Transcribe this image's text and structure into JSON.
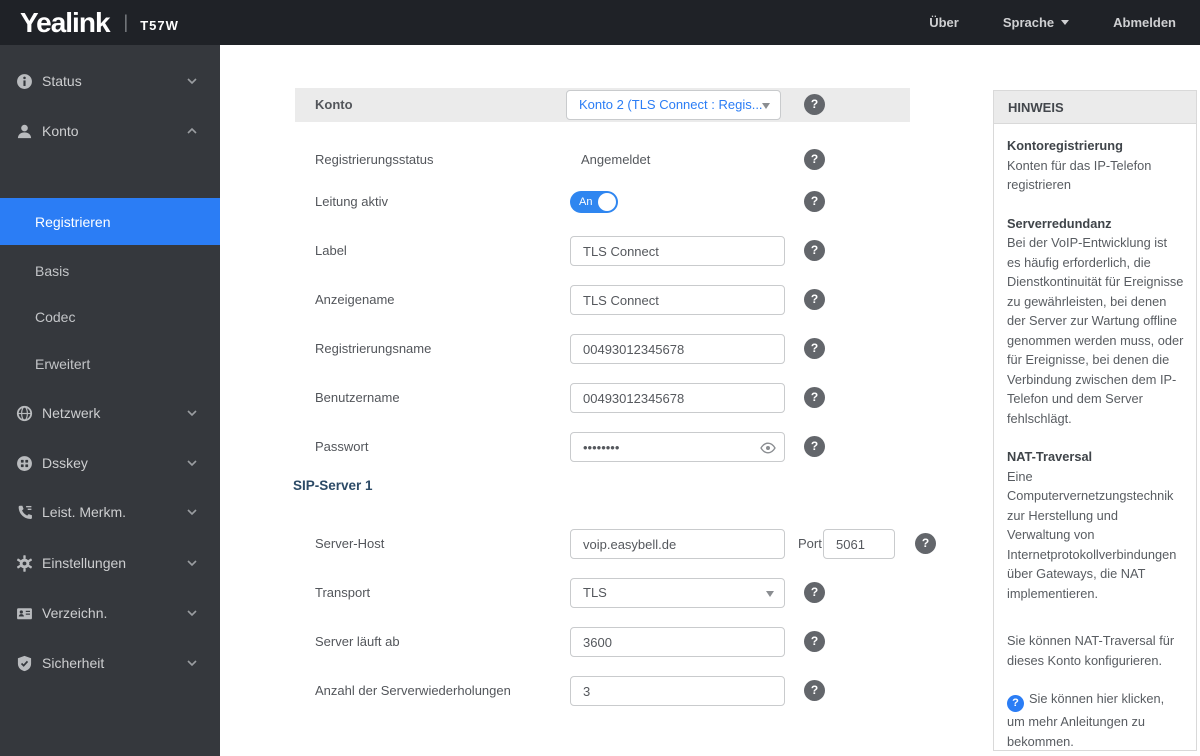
{
  "header": {
    "brand": "Yealink",
    "divider": "|",
    "model": "T57W",
    "links": {
      "about": "Über",
      "language": "Sprache",
      "logout": "Abmelden"
    }
  },
  "sidebar": {
    "items": [
      {
        "label": "Status"
      },
      {
        "label": "Konto"
      },
      {
        "label": "Netzwerk"
      },
      {
        "label": "Dsskey"
      },
      {
        "label": "Leist. Merkm."
      },
      {
        "label": "Einstellungen"
      },
      {
        "label": "Verzeichn."
      },
      {
        "label": "Sicherheit"
      }
    ],
    "konto_submenu": [
      {
        "label": "Registrieren",
        "active": true
      },
      {
        "label": "Basis"
      },
      {
        "label": "Codec"
      },
      {
        "label": "Erweitert"
      }
    ]
  },
  "form": {
    "account_row": {
      "label": "Konto",
      "select_value": "Konto 2 (TLS Connect : Regis..."
    },
    "section_sip": "SIP-Server 1",
    "fields": {
      "registration_status": {
        "label": "Registrierungsstatus",
        "value": "Angemeldet"
      },
      "line_active": {
        "label": "Leitung aktiv",
        "toggle": "An"
      },
      "label": {
        "label": "Label",
        "value": "TLS Connect"
      },
      "display_name": {
        "label": "Anzeigename",
        "value": "TLS Connect"
      },
      "register_name": {
        "label": "Registrierungsname",
        "value": "00493012345678"
      },
      "username": {
        "label": "Benutzername",
        "value": "00493012345678"
      },
      "password": {
        "label": "Passwort",
        "value": "••••••••"
      },
      "server_host": {
        "label": "Server-Host",
        "value": "voip.easybell.de",
        "port_label": "Port",
        "port_value": "5061"
      },
      "transport": {
        "label": "Transport",
        "value": "TLS"
      },
      "server_expires": {
        "label": "Server läuft ab",
        "value": "3600"
      },
      "server_retry": {
        "label": "Anzahl der Serverwiederholungen",
        "value": "3"
      }
    }
  },
  "hint": {
    "title": "HINWEIS",
    "sections": [
      {
        "heading": "Kontoregistrierung",
        "body": "Konten für das IP-Telefon registrieren"
      },
      {
        "heading": "Serverredundanz",
        "body": "Bei der VoIP-Entwicklung ist es häufig erforderlich, die Dienstkontinuität für Ereignisse zu gewährleisten, bei denen der Server zur Wartung offline genommen werden muss, oder für Ereignisse, bei denen die Verbindung zwischen dem IP-Telefon und dem Server fehlschlägt.",
        "break_after_heading": true
      },
      {
        "heading": "NAT-Traversal",
        "body": "Eine Computervernetzungstechnik zur Herstellung und Verwaltung von Internetprotokollverbindungen über Gateways, die NAT implementieren.",
        "break_after_heading": true
      },
      {
        "heading": "",
        "body": "Sie können NAT-Traversal für dieses Konto konfigurieren."
      },
      {
        "heading": "",
        "body": "Sie können hier klicken, um mehr Anleitungen zu bekommen."
      }
    ]
  },
  "icons": {
    "help_glyph": "?"
  },
  "colors": {
    "accent_blue": "#2b7df5",
    "header_dark": "#1f2227",
    "sidebar_dark": "#35383d"
  }
}
